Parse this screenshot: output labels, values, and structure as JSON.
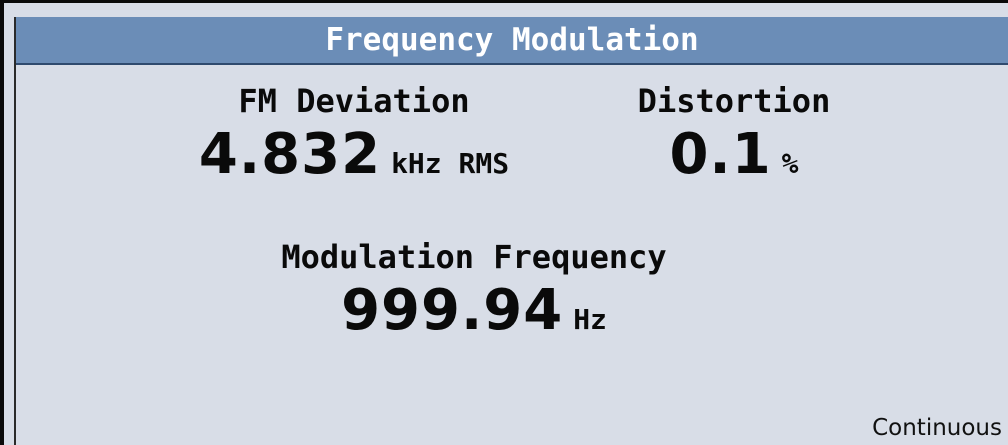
{
  "window": {
    "title": "Frequency Modulation"
  },
  "measurements": {
    "fm_deviation": {
      "label": "FM Deviation",
      "value": "4.832",
      "unit": "kHz RMS"
    },
    "distortion": {
      "label": "Distortion",
      "value": "0.1",
      "unit": "%"
    },
    "modulation_frequency": {
      "label": "Modulation Frequency",
      "value": "999.94",
      "unit": "Hz"
    }
  },
  "status": {
    "mode": "Continuous"
  },
  "colors": {
    "title_bar": "#6b8db7",
    "background": "#d8dde7",
    "text": "#0a0a0a",
    "title_text": "#ffffff"
  }
}
